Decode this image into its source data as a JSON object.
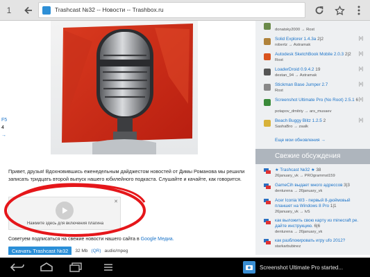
{
  "browser": {
    "tab_count": "1",
    "url_title": "Trashcast №32 -- Новости -- Trashbox.ru"
  },
  "pager": {
    "first": "F5",
    "num": "4",
    "arrow": "→"
  },
  "article": {
    "text": "Привет, друзья! Вдохновившись еженедельным дайджестом новостей от Димы Романова мы решили записать тридцать второй выпуск нашего юбилейного подкаста. Слушайте и качайте, как говорится.",
    "plugin_label": "Нажмите здесь для включения плагина",
    "plugin_close": "✕",
    "source_prefix": "Советуем подписаться на свежие новости нашего сайта в",
    "source_link": "Google Медиа.",
    "download_label": "Скачать Trashcast №32",
    "size": "32 Mb",
    "qr": "(QR)",
    "mime": "audio/mpeg"
  },
  "sidebar": {
    "apps": [
      {
        "name": "",
        "version": "",
        "by": "donatsky2000 → Rost",
        "color": "#6a8a4a",
        "close": ""
      },
      {
        "name": "Solid Explorer 1.4.3a",
        "version": " 2|2",
        "by": "robertz → Astramak",
        "color": "#b0823a",
        "close": "[x]"
      },
      {
        "name": "Autodesk SketchBook Mobile 2.0.3",
        "version": " 2|2",
        "by": "Rost",
        "color": "#d9531e",
        "close": "[x]"
      },
      {
        "name": "LoaderDroid 0.9.4.2",
        "version": " 19",
        "by": "destan_94 → Astramak",
        "color": "#555555",
        "close": "[x]"
      },
      {
        "name": "Stickman Base Jumper 2.7",
        "version": "",
        "by": "Rost",
        "color": "#888888",
        "close": "[x]"
      },
      {
        "name": "Screenshot Ultimate Pro (No Root) 2.5.1",
        "version": " 6",
        "by": "potapov_dmitriy → ars_musaev",
        "color": "#3a8a3a",
        "close": "[x]"
      },
      {
        "name": "Beach Buggy Blitz 1.2.5",
        "version": " 2",
        "by": "SashaBro → zaalk",
        "color": "#d8b23a",
        "close": "[x]"
      }
    ],
    "more": "Еще мои обновления →",
    "section_title": "Свежие обсуждения",
    "discussions": [
      {
        "title": "★ Trashcast №32 ★",
        "count": " 38",
        "by": "26january_vk → PROgrammst159"
      },
      {
        "title": "GameCih выдает много адрессов",
        "count": " 3|3",
        "by": "denturena → 26january_vk"
      },
      {
        "title": "Acer Iconia W3 - первый 8-дюймовый планшет на Windows 8 Pro",
        "count": " 1|1",
        "by": "26january_vk → lvS"
      },
      {
        "title": "как выложить свою карту из minecraft pe. дайте инструкцию.",
        "count": " 6|6",
        "by": "denturena → 26january_vk"
      },
      {
        "title": "как разблокировать игру ufo 2012?",
        "count": "",
        "by": "starkarbubinez"
      }
    ]
  },
  "notification": {
    "text": "Screenshot Ultimate Pro started..."
  }
}
